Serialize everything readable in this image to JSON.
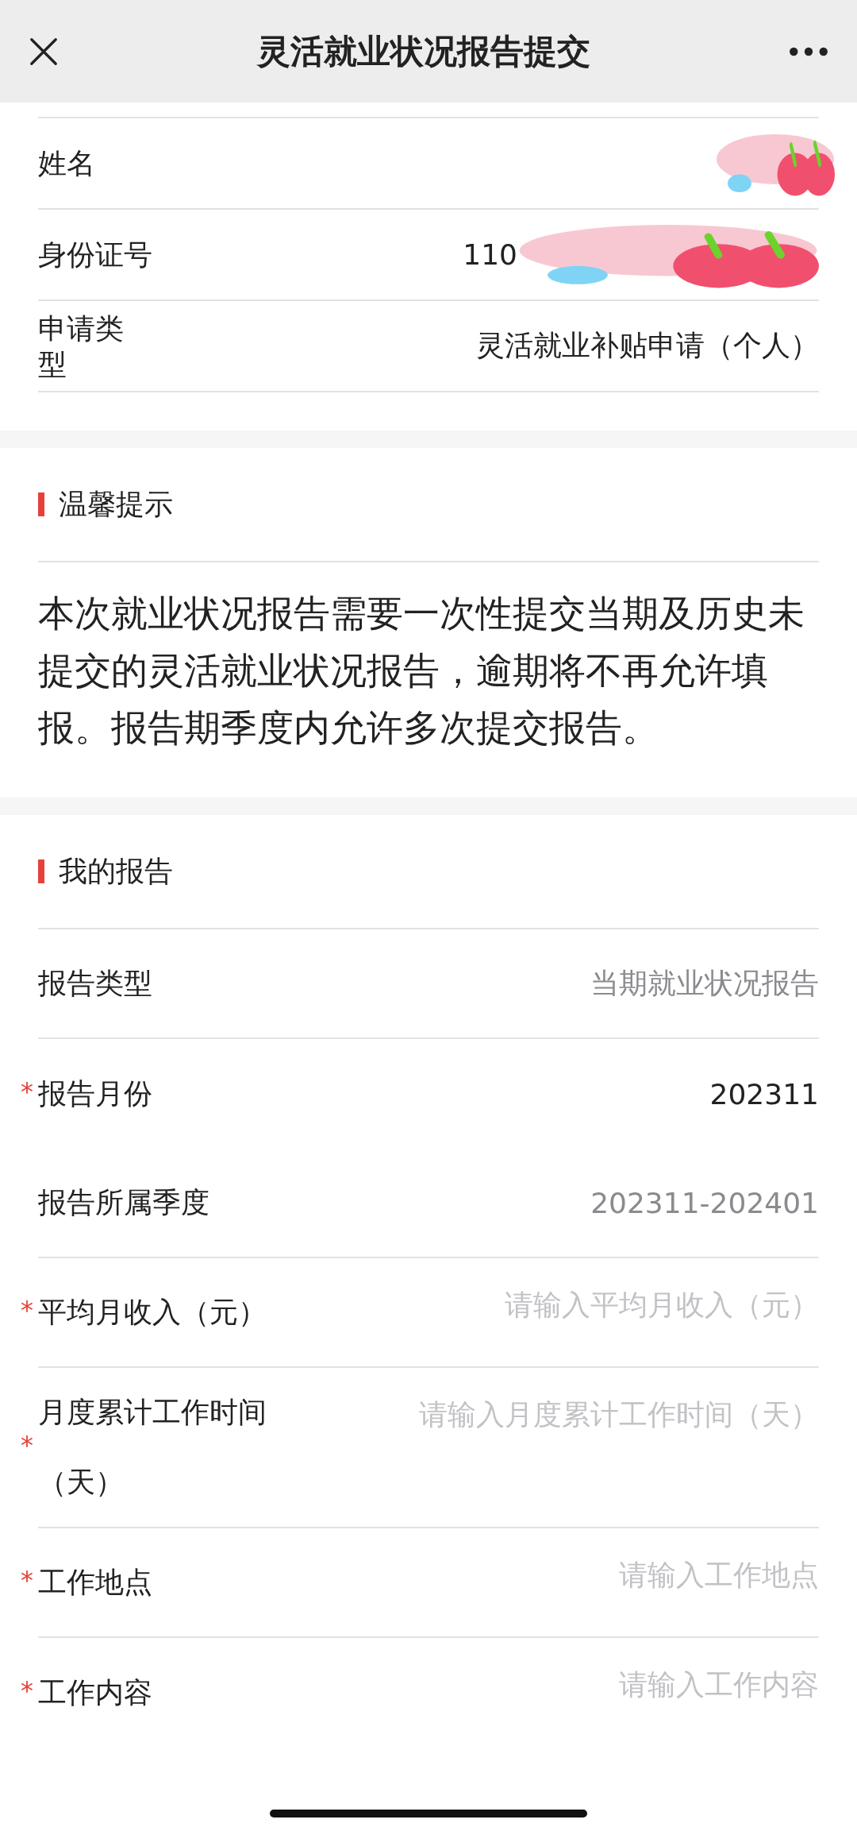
{
  "header": {
    "title": "灵活就业状况报告提交"
  },
  "applicant": [
    {
      "label": "姓名",
      "redacted": true
    },
    {
      "label": "身份证号",
      "value": "110",
      "redacted": true
    },
    {
      "label": "申请类型",
      "value": "灵活就业补贴申请（个人）",
      "redacted": false
    }
  ],
  "notice": {
    "title": "温馨提示",
    "text": "本次就业状况报告需要一次性提交当期及历史未提交的灵活就业状况报告，逾期将不再允许填报。报告期季度内允许多次提交报告。"
  },
  "report": {
    "title": "我的报告",
    "fields": [
      {
        "kind": "display",
        "label": "报告类型",
        "value": "当期就业状况报告",
        "muted": true,
        "divider": true
      },
      {
        "kind": "display",
        "label": "报告月份",
        "value": "202311",
        "marker": "*",
        "muted": false,
        "divider": false
      },
      {
        "kind": "display",
        "label": "报告所属季度",
        "value": "202311-202401",
        "muted": true,
        "divider": true
      },
      {
        "kind": "input",
        "label": "平均月收入（元）",
        "placeholder": "请输入平均月收入（元）",
        "marker": "*",
        "divider": true
      },
      {
        "kind": "input",
        "label": "月度累计工作时间（天）",
        "placeholder": "请输入月度累计工作时间（天）",
        "marker": "*",
        "divider": true
      },
      {
        "kind": "input",
        "label": "工作地点",
        "placeholder": "请输入工作地点",
        "marker": "*",
        "divider": true
      },
      {
        "kind": "input",
        "label": "工作内容",
        "placeholder": "请输入工作内容",
        "marker": "*",
        "divider": false
      }
    ]
  }
}
